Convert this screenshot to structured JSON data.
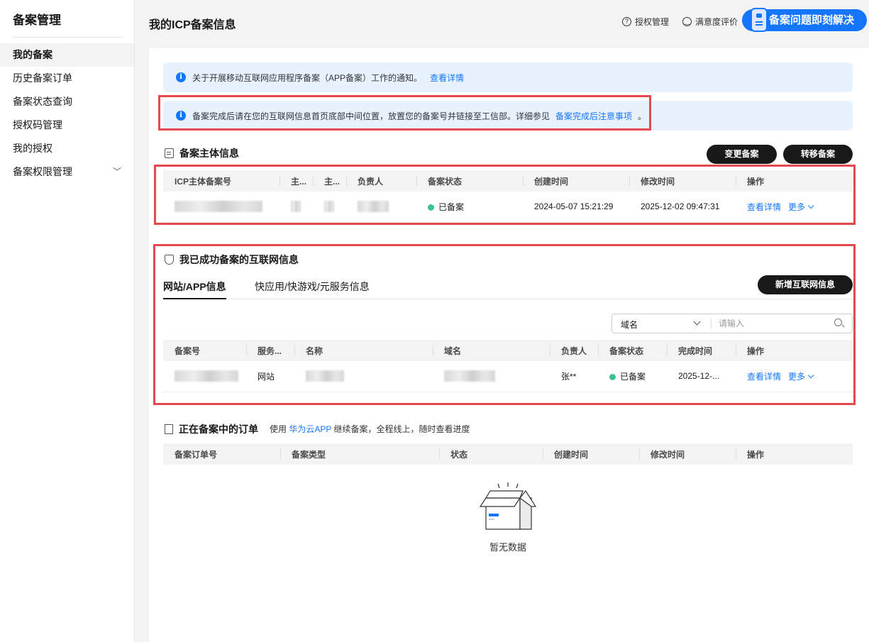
{
  "sidebar": {
    "title": "备案管理",
    "items": [
      {
        "label": "我的备案"
      },
      {
        "label": "历史备案订单"
      },
      {
        "label": "备案状态查询"
      },
      {
        "label": "授权码管理"
      },
      {
        "label": "我的授权"
      },
      {
        "label": "备案权限管理"
      }
    ]
  },
  "header": {
    "title": "我的ICP备案信息",
    "auth_link": "授权管理",
    "satisfaction_link": "满意度评价",
    "help_button": "备案问题即刻解决"
  },
  "notices": [
    {
      "text": "关于开展移动互联网应用程序备案（APP备案）工作的通知。",
      "link": "查看详情",
      "suffix": ""
    },
    {
      "text": "备案完成后请在您的互联网信息首页底部中间位置，放置您的备案号并链接至工信部。详细参见",
      "link": "备案完成后注意事项",
      "suffix": "。"
    }
  ],
  "subject_section": {
    "title": "备案主体信息",
    "change_button": "变更备案",
    "transfer_button": "转移备案",
    "columns": [
      "ICP主体备案号",
      "主...",
      "主...",
      "负责人",
      "备案状态",
      "创建时间",
      "修改时间",
      "操作"
    ],
    "row": {
      "status": "已备案",
      "created": "2024-05-07 15:21:29",
      "modified": "2025-12-02 09:47:31",
      "detail_link": "查看详情",
      "more_link": "更多"
    }
  },
  "internet_section": {
    "title": "我已成功备案的互联网信息",
    "tabs": [
      "网站/APP信息",
      "快应用/快游戏/元服务信息"
    ],
    "add_button": "新增互联网信息",
    "search": {
      "type_selected": "域名",
      "placeholder": "请输入"
    },
    "columns": [
      "备案号",
      "服务...",
      "名称",
      "域名",
      "负责人",
      "备案状态",
      "完成时间",
      "操作"
    ],
    "row": {
      "service": "网站",
      "owner": "张**",
      "status": "已备案",
      "completed": "2025-12-...",
      "detail_link": "查看详情",
      "more_link": "更多"
    }
  },
  "orders_section": {
    "title": "正在备案中的订单",
    "sub_prefix": "使用",
    "sub_link": "华为云APP",
    "sub_suffix": "继续备案，全程线上，随时查看进度",
    "columns": [
      "备案订单号",
      "备案类型",
      "状态",
      "创建时间",
      "修改时间",
      "操作"
    ],
    "empty_text": "暂无数据"
  },
  "colors": {
    "accent": "#1476ff",
    "status_green": "#3ac295",
    "highlight_red": "#e5484d",
    "dark_button": "#191919"
  }
}
